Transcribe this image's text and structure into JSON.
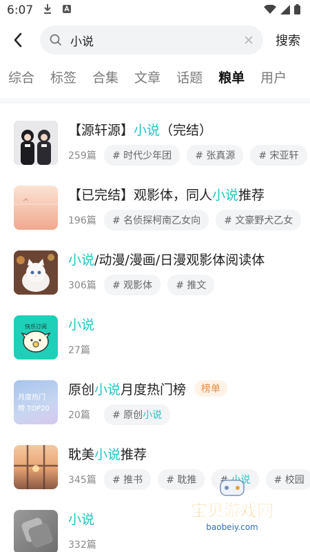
{
  "status": {
    "time": "6:07"
  },
  "search": {
    "value": "小说",
    "action": "搜索"
  },
  "tabs": [
    "综合",
    "标签",
    "合集",
    "文章",
    "话题",
    "粮单",
    "用户"
  ],
  "active_tab": "粮单",
  "colors": {
    "highlight": "#22c3c3",
    "badge": "#f08a3c"
  },
  "results": [
    {
      "title_parts": [
        "【源轩源】",
        "小说",
        "（完结）"
      ],
      "count": "259篇",
      "tags": [
        [
          "# 时代少年团"
        ],
        [
          "# 张真源"
        ],
        [
          "# 宋亚轩"
        ]
      ]
    },
    {
      "title_parts": [
        "【已完结】观影体，同人",
        "小说",
        "推荐"
      ],
      "count": "196篇",
      "tags": [
        [
          "# 名侦探柯南乙女向"
        ],
        [
          "# 文豪野犬乙女"
        ]
      ]
    },
    {
      "title_parts": [
        "",
        "小说",
        "/动漫/漫画/日漫观影体阅读体"
      ],
      "count": "306篇",
      "tags": [
        [
          "# 观影体"
        ],
        [
          "# 推文"
        ]
      ]
    },
    {
      "title_parts": [
        "",
        "小说",
        ""
      ],
      "count": "27篇",
      "tags": []
    },
    {
      "title_parts": [
        "原创",
        "小说",
        "月度热门榜"
      ],
      "badge": "榜单",
      "count": "20篇",
      "tags": [
        [
          "# 原创",
          "小说"
        ]
      ]
    },
    {
      "title_parts": [
        "耽美",
        "小说",
        "推荐"
      ],
      "count": "345篇",
      "tags": [
        [
          "# 推书"
        ],
        [
          "# 耽推"
        ],
        [
          "# ",
          "小说"
        ],
        [
          "# 校园"
        ]
      ]
    },
    {
      "title_parts": [
        "",
        "小说",
        ""
      ],
      "count": "332篇",
      "tags": []
    }
  ],
  "thumb_text": {
    "r3": "快乐订阅",
    "r4_line1": "月度热门",
    "r4_line2": "榜 TOP20"
  },
  "watermark": {
    "name": "宝贝游戏网",
    "url": "baobeiy.com"
  }
}
